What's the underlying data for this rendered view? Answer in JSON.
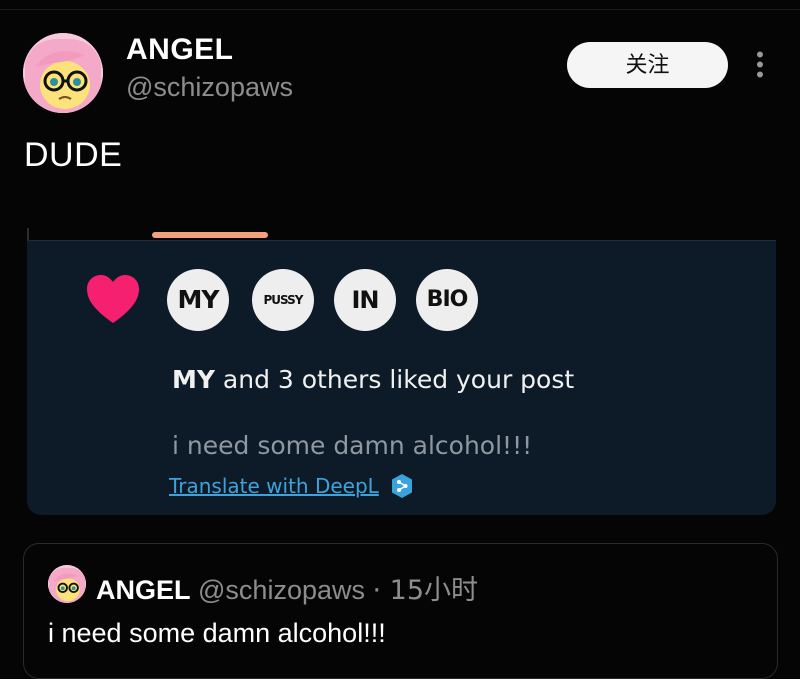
{
  "post": {
    "author_name": "ANGEL",
    "author_handle": "@schizopaws",
    "follow_label": "关注",
    "more_icon": "more-vertical-icon",
    "text": "DUDE"
  },
  "attachment": {
    "badges": [
      "MY",
      "PUSSY",
      "IN",
      "BIO"
    ],
    "liked_bold": "MY",
    "liked_rest": " and 3 others liked your post",
    "quote": "i need some damn alcohol!!!",
    "translate_label": "Translate with DeepL",
    "heart_color": "#f5206f",
    "link_color": "#3fa2da"
  },
  "quoted_post": {
    "author_name": "ANGEL",
    "author_handle": "@schizopaws",
    "time": "· 15小时",
    "text": "i need some damn alcohol!!!"
  }
}
